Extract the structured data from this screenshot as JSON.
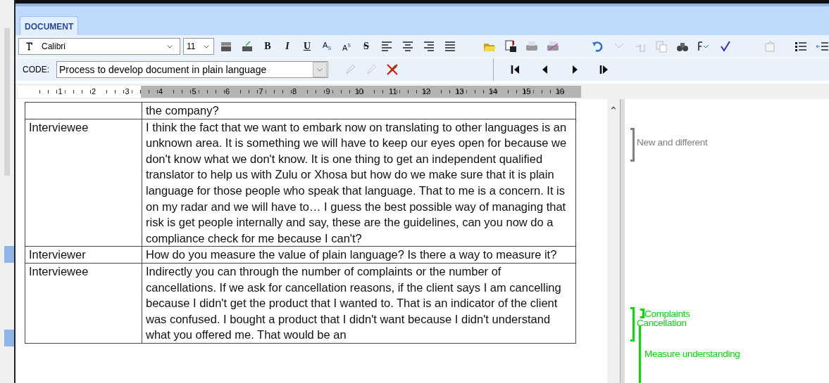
{
  "tab": {
    "label": "DOCUMENT",
    "selected": true
  },
  "format_bar": {
    "font": "Calibri",
    "size": "11",
    "buttons": [
      {
        "kind": "bold",
        "label": "B"
      },
      {
        "kind": "italic",
        "label": "I"
      },
      {
        "kind": "underline",
        "label": "U"
      },
      {
        "kind": "plain",
        "label": "A$_{s}$"
      },
      {
        "kind": "plain",
        "label": "A$^{s}$"
      },
      {
        "kind": "strike",
        "label": "S"
      }
    ]
  },
  "code_bar": {
    "label": "CODE:",
    "value": "Process to develop document in plain language"
  },
  "ruler": {
    "marks": [
      "1",
      "2",
      "3",
      "4",
      "5",
      "6",
      "7",
      "8",
      "9",
      "10",
      "11",
      "12",
      "13",
      "14",
      "15",
      "16"
    ]
  },
  "table": {
    "rows": [
      {
        "text": "the company?"
      },
      {
        "speaker": "Interviewee",
        "text": "I think the fact that we want to embark now on translating to other languages is an unknown area. It is something we will have to keep our eyes open for because we don't know what we don't know. It is one thing to get an independent qualified translator to help us with Zulu or Xhosa but how do we make sure that it is plain language for those people who speak that language. That to me is a concern. It is on my radar and we will have to… I guess the best possible way of managing that risk is get people internally and say, these are the guidelines, can you now do a compliance check for me because I can't?"
      },
      {
        "speaker": "Interviewer",
        "text": "How do you measure the value of plain language? Is there a way to measure it?"
      },
      {
        "speaker": "Interviewee",
        "text": "Indirectly you can through the number of complaints or the number of cancellations. If we ask for cancellation reasons, if the client says I am cancelling because I didn't get the product that I wanted to. That is an indicator of the client was confused. I bought a product that I didn't want because I didn't understand what you offered me. That would be an"
      }
    ]
  },
  "codes": [
    {
      "label": "New and different",
      "color": "#808080"
    },
    {
      "label": "Complaints",
      "color": "#00e000"
    },
    {
      "label": "Cancellation",
      "color": "#00e000"
    },
    {
      "label": "Measure understanding",
      "color": "#00e000"
    }
  ]
}
